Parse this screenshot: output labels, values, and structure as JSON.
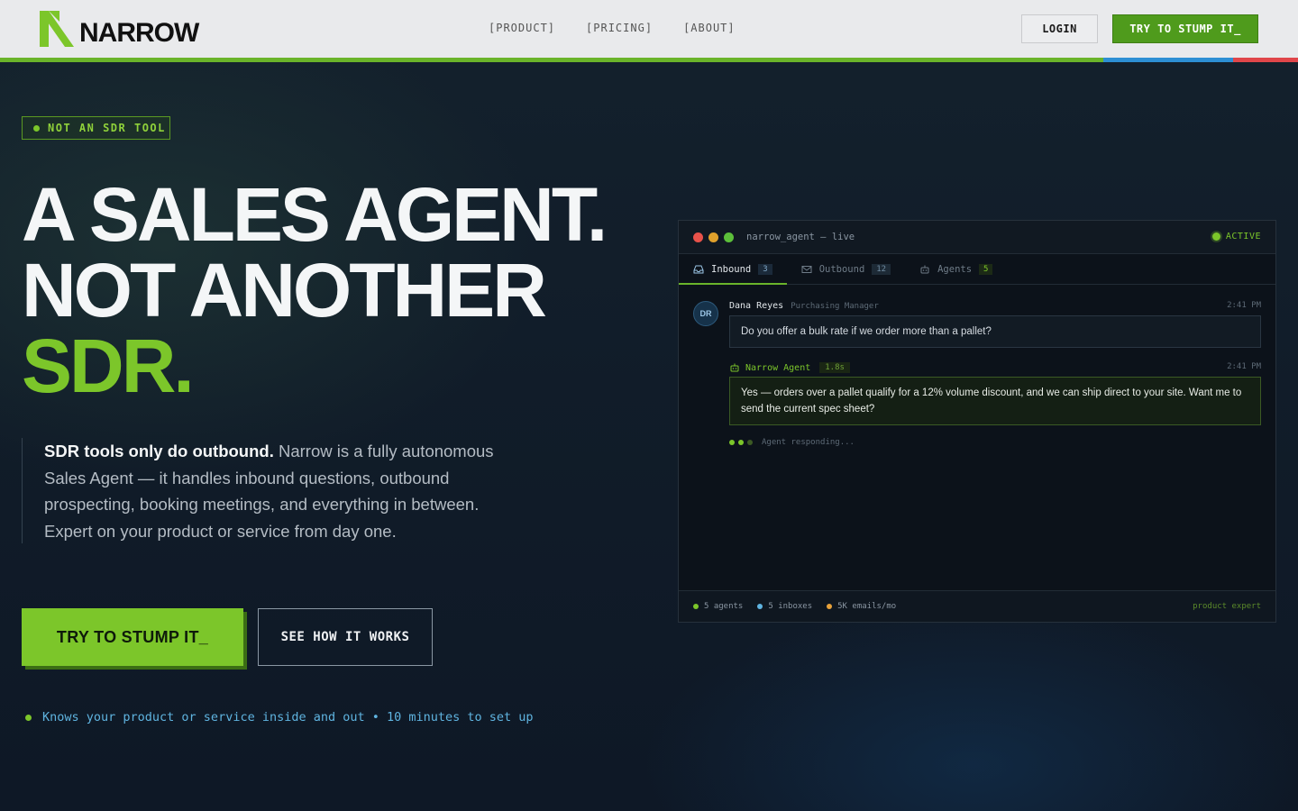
{
  "brand": {
    "name": "NARROW",
    "accent": "#7cc62a"
  },
  "nav": {
    "items": [
      "[PRODUCT]",
      "[PRICING]",
      "[ABOUT]"
    ]
  },
  "header": {
    "login_label": "LOGIN",
    "cta_label": "TRY TO STUMP IT_"
  },
  "hero": {
    "badge": "NOT AN SDR TOOL",
    "headline_line1": "A SALES AGENT.",
    "headline_line2": "NOT ANOTHER",
    "headline_line3": "SDR.",
    "lede_bold": "SDR tools only do outbound.",
    "lede_rest": " Narrow is a fully autonomous Sales Agent — it handles inbound questions, outbound prospecting, booking meetings, and everything in between. Expert on your product or service from day one.",
    "cta_primary": "TRY TO STUMP IT_",
    "cta_secondary": "SEE HOW IT WORKS",
    "footnote": "Knows your product or service inside and out • 10 minutes to set up"
  },
  "console": {
    "title": "narrow_agent — live",
    "status": "ACTIVE",
    "tabs": [
      {
        "label": "Inbound",
        "count": "3"
      },
      {
        "label": "Outbound",
        "count": "12"
      },
      {
        "label": "Agents",
        "count": "5"
      }
    ],
    "customer": {
      "initials": "DR",
      "name": "Dana Reyes",
      "role": "Purchasing Manager",
      "time": "2:41 PM",
      "message": "Do you offer a bulk rate if we order more than a pallet?"
    },
    "agent": {
      "name": "Narrow Agent",
      "latency": "1.8s",
      "time": "2:41 PM",
      "message": "Yes — orders over a pallet qualify for a 12% volume discount, and we can ship direct to your site. Want me to send the current spec sheet?"
    },
    "typing": "Agent responding...",
    "footer": {
      "stats": [
        "5 agents",
        "5 inboxes",
        "5K emails/mo"
      ],
      "stat_colors": [
        "#7cc62a",
        "#5fb4e0",
        "#e8a23a"
      ],
      "tag": "product expert"
    }
  }
}
